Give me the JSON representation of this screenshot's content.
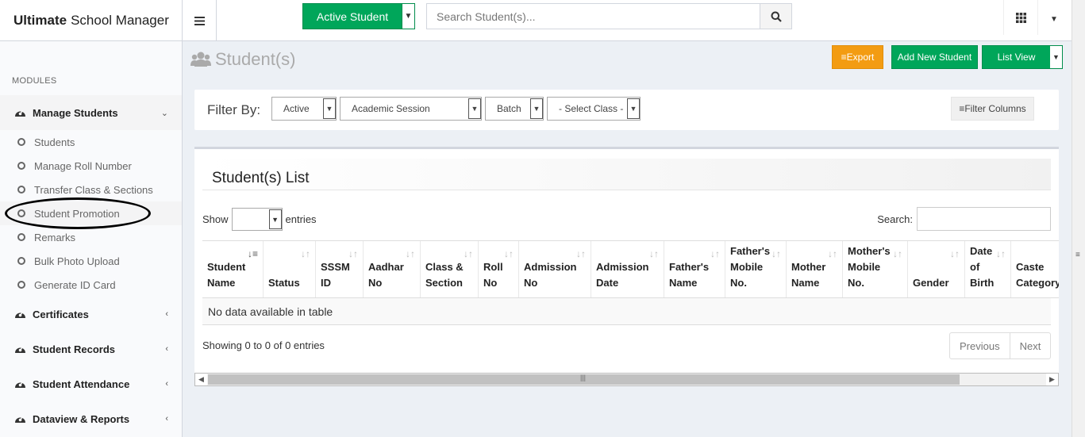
{
  "header": {
    "brand_bold": "Ultimate",
    "brand_rest": "School Manager",
    "active_student_label": "Active Student",
    "search_placeholder": "Search Student(s)..."
  },
  "sidebar": {
    "modules_label": "MODULES",
    "manage_students": "Manage Students",
    "sub_items": [
      "Students",
      "Manage Roll Number",
      "Transfer Class & Sections",
      "Student Promotion",
      "Remarks",
      "Bulk Photo Upload",
      "Generate ID Card"
    ],
    "certificates": "Certificates",
    "student_records": "Student Records",
    "student_attendance": "Student Attendance",
    "dataview_reports": "Dataview & Reports"
  },
  "content": {
    "page_title": "Student(s)",
    "export_label": "Export",
    "add_new_label": "Add New Student",
    "list_view_label": "List View",
    "filter_by": "Filter By:",
    "filter_status": "Active",
    "filter_session": "Academic Session",
    "filter_batch": "Batch",
    "filter_class": "- Select Class -",
    "filter_columns": "Filter Columns",
    "list_title": "Student(s) List",
    "show_label": "Show",
    "entries_label": "entries",
    "search_label": "Search:",
    "columns": [
      [
        "Student",
        "Name"
      ],
      [
        "Status"
      ],
      [
        "SSSM",
        "ID"
      ],
      [
        "Aadhar",
        "No"
      ],
      [
        "Class &",
        "Section"
      ],
      [
        "Roll",
        "No"
      ],
      [
        "Admission",
        "No"
      ],
      [
        "Admission",
        "Date"
      ],
      [
        "Father's",
        "Name"
      ],
      [
        "Father's",
        "Mobile",
        "No."
      ],
      [
        "Mother",
        "Name"
      ],
      [
        "Mother's",
        "Mobile",
        "No."
      ],
      [
        "Gender"
      ],
      [
        "Date",
        "of",
        "Birth"
      ],
      [
        "Caste",
        "Category"
      ]
    ],
    "no_data": "No data available in table",
    "info": "Showing 0 to 0 of 0 entries",
    "previous": "Previous",
    "next": "Next"
  }
}
